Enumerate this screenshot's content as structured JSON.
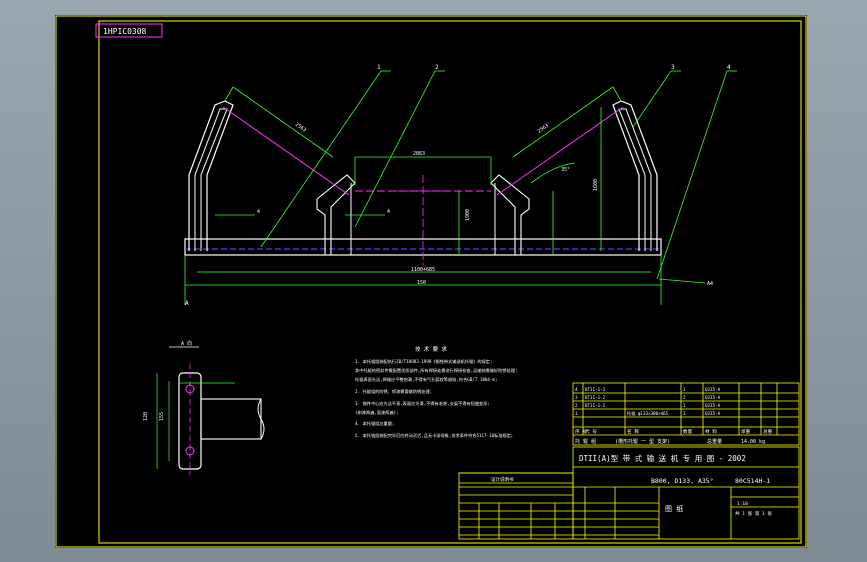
{
  "drawing": {
    "code_box": "1HPIC0308",
    "callouts": [
      "1",
      "2",
      "3",
      "4"
    ],
    "dims": {
      "left_roller": "2563",
      "center_roller": "2863",
      "right_roller": "2563",
      "height_mid": "1900",
      "height_right": "1600",
      "total_inner": "1100+685",
      "total_outer": "150"
    },
    "angle_note": "35°",
    "section_label": "A",
    "view_label": "A 向",
    "side_view_dims": [
      "120",
      "155"
    ],
    "weld_symbols": [
      "4",
      "4",
      "4"
    ],
    "leader_label": "A4"
  },
  "notes": {
    "title": "技 术 要 求",
    "lines": [
      "1. 本托辊组装配执行JB/T10983-1998《钢铁带式输送机托辊》的规定;",
      "   其中托辊的密封件需配置优质部件,所有焊接处需进行焊接检查,运输前需做好防锈处理;",
      "   托辊表面光洁,焊缝应平整饱满,不得有气孔裂纹等缺陷,符合GB/T 1804-m;",
      "2. 托辊组的防锈、喷漆需要做防锈处理;",
      "3. 钢件中心应光洁平直,表面应光滑,不得有毛刺,支架不得有扭曲变形;",
      "   (刷漆两遍,面漆两遍);",
      "4. 本托辊组总重量;",
      "5. 本托辊组装配完毕后应转动灵活,且无卡滞现象,技术条件符合5117-10标准规定。"
    ]
  },
  "bom": {
    "rows": [
      [
        "4",
        "DTII-1-3",
        "",
        "1",
        "Q235-A",
        "",
        ""
      ],
      [
        "3",
        "DTII-1-2",
        "",
        "2",
        "Q235-A",
        "",
        ""
      ],
      [
        "2",
        "DTII-1-1",
        "",
        "1",
        "Q235-A",
        "",
        ""
      ],
      [
        "1",
        "",
        "托辊 φ133×380×465",
        "3",
        "Q235-A",
        "",
        ""
      ]
    ],
    "header": [
      "序 号",
      "代 号",
      "名 称",
      "数量",
      "材 料",
      "单重",
      "总重"
    ],
    "summary": [
      "托 辊 组",
      "(槽形托辊 一 型 支架)",
      "总重量",
      "14.00 kg"
    ]
  },
  "title_block": {
    "project": "DTII(A)型 带 式 输 送 机 专 用 图 - 2002",
    "spec": "B800, D133, A35°",
    "drawing_no": "80C514H-1",
    "name": "图 纸",
    "revision_title": "设计说明书",
    "scale": "1:10",
    "sheet": "共 1 张  第 1 张"
  }
}
